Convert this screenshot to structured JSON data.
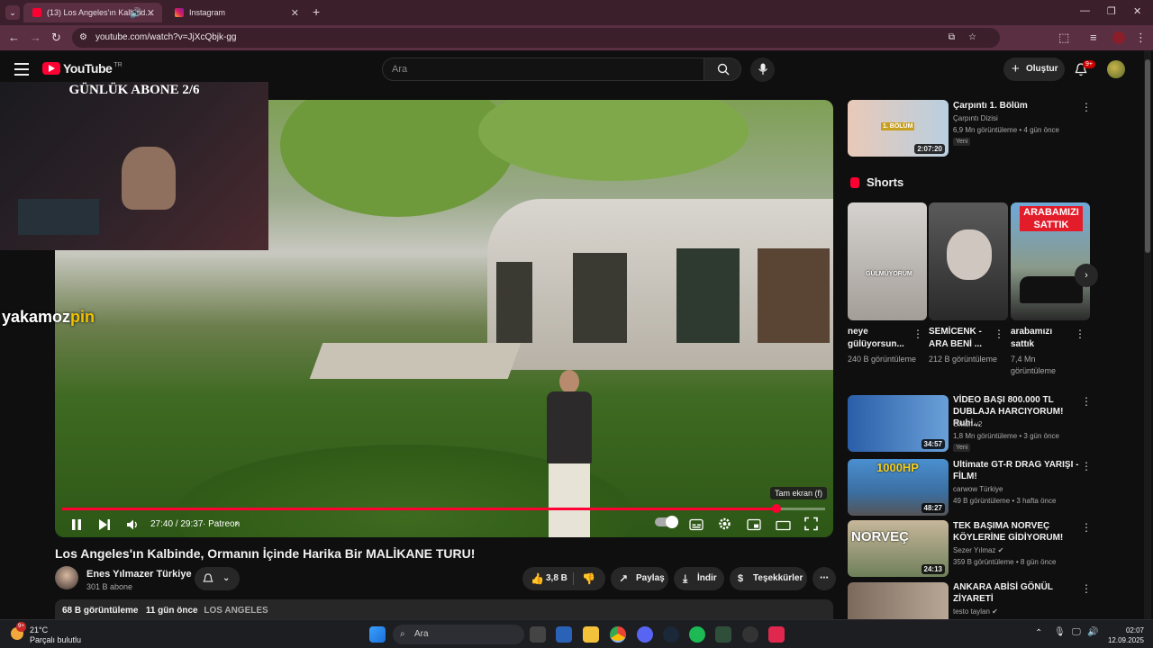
{
  "browser": {
    "tabs": [
      {
        "title": "(13) Los Angeles'ın Kalbind...",
        "active": true
      },
      {
        "title": "Instagram",
        "active": false
      }
    ],
    "new_tab": "+",
    "url": "youtube.com/watch?v=JjXcQbjk-gg"
  },
  "header": {
    "logo_text": "YouTube",
    "country_code": "TR",
    "search_placeholder": "Ara",
    "create_label": "Oluştur",
    "notifications_badge": "9+"
  },
  "overlay": {
    "title": "GÜNLÜK ABONE 2/6",
    "watermark_a": "yakamoz",
    "watermark_b": "pin"
  },
  "player": {
    "time": "27:40 / 29:37",
    "chapter": "· Patreon",
    "progress": 0.936,
    "tooltip": "Tam ekran (f)"
  },
  "video": {
    "title": "Los Angeles'ın Kalbinde, Ormanın İçinde Harika Bir MALİKANE TURU!",
    "channel": "Enes Yılmazer Türkiye",
    "subscribers": "301 B abone",
    "likes": "3,8 B",
    "share_label": "Paylaş",
    "download_label": "İndir",
    "thanks_label": "Teşekkürler",
    "views": "68 B görüntüleme",
    "age": "11 gün önce",
    "location": "LOS ANGELES"
  },
  "sidebar": {
    "first": {
      "title": "Çarpıntı 1. Bölüm",
      "channel": "Çarpıntı Dizisi",
      "meta": "6,9 Mn görüntüleme • 4 gün önce",
      "tag": "Yeni",
      "duration": "2:07:20",
      "thumb_text": "1. BÖLÜM"
    },
    "shorts_heading": "Shorts",
    "shorts": [
      {
        "title": "neye gülüyorsun...",
        "meta": "240 B görüntüleme",
        "overlay": "GÜLMÜYORUM"
      },
      {
        "title": "SEMİCENK - ARA BENİ ...",
        "meta": "212 B görüntüleme",
        "overlay": ""
      },
      {
        "title": "arabamızı sattık",
        "meta": "7,4 Mn görüntüleme",
        "overlay": "ARABAMIZI SATTIK"
      }
    ],
    "videos": [
      {
        "title": "VİDEO BAŞI 800.000 TL DUBLAJA HARCIYORUM! Ruhi...",
        "channel": "Orkun v2",
        "meta": "1,8 Mn görüntüleme • 3 gün önce",
        "tag": "Yeni",
        "duration": "34:57",
        "thumb_text": ""
      },
      {
        "title": "Ultimate GT-R DRAG YARIŞI - FİLM!",
        "channel": "carwow Türkiye",
        "meta": "49 B görüntüleme • 3 hafta önce",
        "tag": "",
        "duration": "48:27",
        "thumb_text": "1000HP"
      },
      {
        "title": "TEK BAŞIMA NORVEÇ KÖYLERİNE GİDİYORUM!",
        "channel": "Sezer Yılmaz",
        "meta": "359 B görüntüleme • 8 gün önce",
        "tag": "",
        "duration": "24:13",
        "thumb_text": "NORVEÇ"
      },
      {
        "title": "ANKARA ABİSİ GÖNÜL ZİYARETİ",
        "channel": "testo taylan",
        "meta": "",
        "tag": "",
        "duration": "",
        "thumb_text": ""
      }
    ]
  },
  "taskbar": {
    "temp": "21°C",
    "weather": "Parçalı bulutlu",
    "search": "Ara",
    "time": "02:07",
    "date": "12.09.2025",
    "badge": "9+"
  }
}
